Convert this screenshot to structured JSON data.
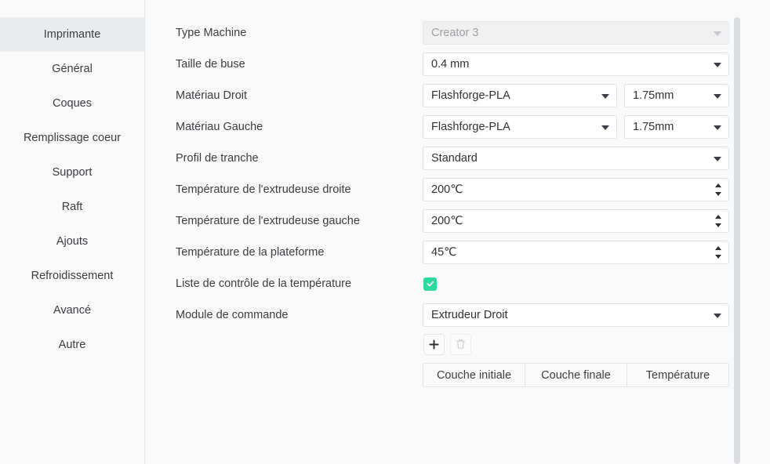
{
  "sidebar": {
    "items": [
      {
        "label": "Imprimante",
        "selected": true
      },
      {
        "label": "Général",
        "selected": false
      },
      {
        "label": "Coques",
        "selected": false
      },
      {
        "label": "Remplissage coeur",
        "selected": false
      },
      {
        "label": "Support",
        "selected": false
      },
      {
        "label": "Raft",
        "selected": false
      },
      {
        "label": "Ajouts",
        "selected": false
      },
      {
        "label": "Refroidissement",
        "selected": false
      },
      {
        "label": "Avancé",
        "selected": false
      },
      {
        "label": "Autre",
        "selected": false
      }
    ]
  },
  "form": {
    "machine_type": {
      "label": "Type Machine",
      "value": "Creator 3",
      "disabled": true,
      "icon": "chevron-down-icon"
    },
    "nozzle_size": {
      "label": "Taille de buse",
      "value": "0.4 mm",
      "icon": "chevron-down-icon"
    },
    "material_right": {
      "label": "Matériau Droit",
      "value": "Flashforge-PLA",
      "diameter": "1.75mm",
      "icon": "chevron-down-icon"
    },
    "material_left": {
      "label": "Matériau Gauche",
      "value": "Flashforge-PLA",
      "diameter": "1.75mm",
      "icon": "chevron-down-icon"
    },
    "slice_profile": {
      "label": "Profil de tranche",
      "value": "Standard",
      "icon": "chevron-down-icon"
    },
    "temp_right_extruder": {
      "label": "Température de l'extrudeuse droite",
      "value": "200℃",
      "icon": "spinner-icon"
    },
    "temp_left_extruder": {
      "label": "Température de l'extrudeuse gauche",
      "value": "200℃",
      "icon": "spinner-icon"
    },
    "temp_platform": {
      "label": "Température de la plateforme",
      "value": "45℃",
      "icon": "spinner-icon"
    },
    "temp_control_list": {
      "label": "Liste de contrôle de la température",
      "checked": true,
      "icon": "checkmark-icon"
    },
    "control_module": {
      "label": "Module de commande",
      "value": "Extrudeur Droit",
      "icon": "chevron-down-icon"
    }
  },
  "toolbar": {
    "add_label": "+",
    "add_icon": "plus-icon",
    "delete_icon": "trash-icon",
    "delete_disabled": true
  },
  "table": {
    "columns": [
      "Couche initiale",
      "Couche finale",
      "Température"
    ],
    "rows": []
  },
  "colors": {
    "accent_green": "#2ed8a0",
    "background": "#f9f9fa",
    "field_background": "#ffffff",
    "field_border": "#dfe1e4",
    "selected_item": "#eaebed",
    "text": "#3a3d42",
    "disabled_text": "#9b9fa4",
    "scrollbar_thumb": "#dadce0"
  }
}
